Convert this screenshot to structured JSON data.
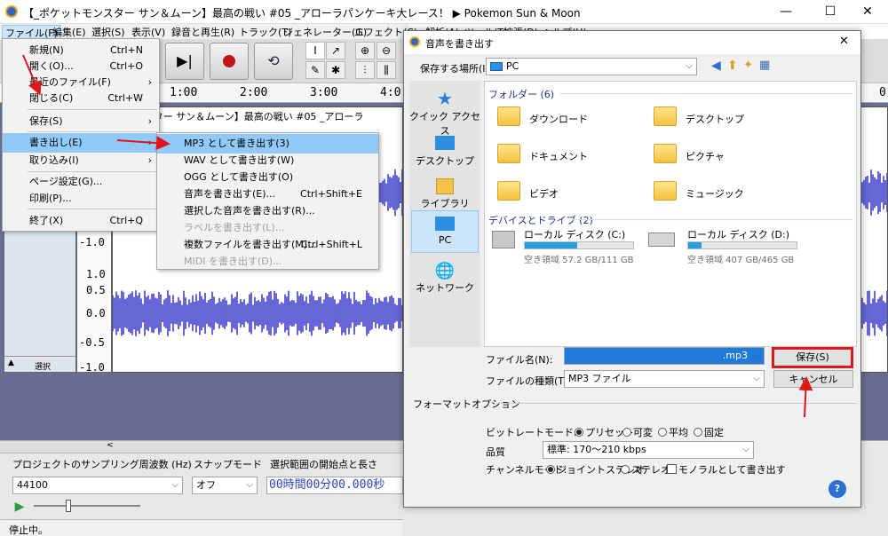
{
  "window": {
    "title": "【_ポケットモンスター サン＆ムーン】最高の戦い #05 _アローラパンケーキ大レース！ ▶ Pokemon Sun & Moon",
    "min": "—",
    "max": "☐",
    "close": "✕"
  },
  "menubar": [
    "ファイル(F)",
    "編集(E)",
    "選択(S)",
    "表示(V)",
    "録音と再生(R)",
    "トラック(T)",
    "ジェネレーター(G)",
    "エフェクト(C)"
  ],
  "menubar_right": [
    "解析(A)",
    "ツール(T)",
    "拡張(D)",
    "ヘルプ(H)"
  ],
  "timeline": [
    "1:00",
    "2:00",
    "3:00",
    "4:0"
  ],
  "timeline_right": "0",
  "track": {
    "name": "トモンスター サン＆ムーン】最高の戦い #05 _アローラ",
    "scale": [
      "-1.0",
      "1.0",
      "0.5",
      "0.0",
      "-0.5",
      "-1.0"
    ],
    "select_label": "選択",
    "colors": {
      "wave": "#3232c8",
      "panel": "#dfe5ef",
      "bg": "#6a6d92"
    }
  },
  "file_menu": [
    {
      "label": "新規(N)",
      "shortcut": "Ctrl+N"
    },
    {
      "label": "開く(O)...",
      "shortcut": "Ctrl+O"
    },
    {
      "label": "最近のファイル(F)",
      "shortcut": "›"
    },
    {
      "label": "閉じる(C)",
      "shortcut": "Ctrl+W"
    },
    {
      "label": "保存(S)",
      "shortcut": "›"
    },
    {
      "label": "書き出し(E)",
      "shortcut": "›"
    },
    {
      "label": "取り込み(I)",
      "shortcut": "›"
    },
    {
      "label": "ページ設定(G)...",
      "shortcut": ""
    },
    {
      "label": "印刷(P)...",
      "shortcut": ""
    },
    {
      "label": "終了(X)",
      "shortcut": "Ctrl+Q"
    }
  ],
  "export_menu": [
    {
      "label": "MP3 として書き出す(3)",
      "shortcut": ""
    },
    {
      "label": "WAV として書き出す(W)",
      "shortcut": ""
    },
    {
      "label": "OGG として書き出す(O)",
      "shortcut": ""
    },
    {
      "label": "音声を書き出す(E)...",
      "shortcut": "Ctrl+Shift+E"
    },
    {
      "label": "選択した音声を書き出す(R)...",
      "shortcut": ""
    },
    {
      "label": "ラベルを書き出す(L)...",
      "shortcut": ""
    },
    {
      "label": "複数ファイルを書き出す(M)...",
      "shortcut": "Ctrl+Shift+L"
    },
    {
      "label": "MIDI を書き出す(D)...",
      "shortcut": ""
    }
  ],
  "bottom": {
    "rate_label": "プロジェクトのサンプリング周波数 (Hz)",
    "snap_label": "スナップモード",
    "sel_label": "選択範囲の開始点と長さ",
    "rate_value": "44100",
    "snap_value": "オフ",
    "time_value": "00時間00分00.000秒",
    "status": "停止中。",
    "play_icon": "▶"
  },
  "dialog": {
    "title": "音声を書き出す",
    "close": "✕",
    "save_in_label": "保存する場所(I):",
    "save_in_value": "PC",
    "places": [
      "クイック アクセス",
      "デスクトップ",
      "ライブラリ",
      "PC",
      "ネットワーク"
    ],
    "folders_header": "フォルダー (6)",
    "folders": [
      "ダウンロード",
      "デスクトップ",
      "ドキュメント",
      "ピクチャ",
      "ビデオ",
      "ミュージック"
    ],
    "drives_header": "デバイスとドライブ (2)",
    "drives": [
      {
        "name": "ローカル ディスク (C:)",
        "free": "空き領域 57.2 GB/111 GB",
        "used_fraction": 0.48
      },
      {
        "name": "ローカル ディスク (D:)",
        "free": "空き領域 407 GB/465 GB",
        "used_fraction": 0.12
      }
    ],
    "filename_label": "ファイル名(N):",
    "filename_value": ".mp3",
    "filetype_label": "ファイルの種類(T):",
    "filetype_value": "MP3 ファイル",
    "save_button": "保存(S)",
    "cancel_button": "キャンセル",
    "format_options": "フォーマットオプション",
    "bitrate_label": "ビットレートモード:",
    "bitrate_options": [
      "プリセット",
      "可変",
      "平均",
      "固定"
    ],
    "quality_label": "品質",
    "quality_value": "標準: 170～210 kbps",
    "channel_label": "チャンネルモード:",
    "channel_options": [
      "ジョイントステレオ",
      "ステレオ",
      "モノラルとして書き出す"
    ],
    "help": "?"
  }
}
